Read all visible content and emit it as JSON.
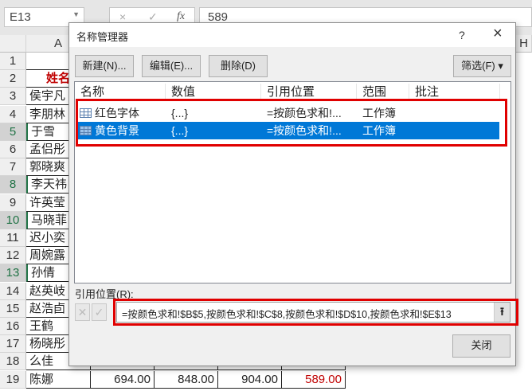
{
  "toolbar": {
    "name_box": "E13",
    "cancel_icon": "×",
    "enter_icon": "✓",
    "fx": "fx",
    "formula_value": "589"
  },
  "columns": [
    "A",
    "H"
  ],
  "rows": [
    {
      "n": "1",
      "name": "",
      "sel": false
    },
    {
      "n": "2",
      "name": "姓名",
      "sel": false
    },
    {
      "n": "3",
      "name": "侯宇凡",
      "sel": false
    },
    {
      "n": "4",
      "name": "李朋林",
      "sel": false
    },
    {
      "n": "5",
      "name": "于雪",
      "sel": true
    },
    {
      "n": "6",
      "name": "孟侣彤",
      "sel": false
    },
    {
      "n": "7",
      "name": "郭晓爽",
      "sel": false
    },
    {
      "n": "8",
      "name": "李天祎",
      "sel": true
    },
    {
      "n": "9",
      "name": "许英莹",
      "sel": false
    },
    {
      "n": "10",
      "name": "马晓菲",
      "sel": true
    },
    {
      "n": "11",
      "name": "迟小奕",
      "sel": false
    },
    {
      "n": "12",
      "name": "周婉露",
      "sel": false
    },
    {
      "n": "13",
      "name": "孙倩",
      "sel": true
    },
    {
      "n": "14",
      "name": "赵英岐",
      "sel": false
    },
    {
      "n": "15",
      "name": "赵浩卣",
      "sel": false
    },
    {
      "n": "16",
      "name": "王鹤",
      "sel": false
    },
    {
      "n": "17",
      "name": "杨晓彤",
      "sel": false
    },
    {
      "n": "18",
      "name": "么佳",
      "sel": false
    },
    {
      "n": "19",
      "name": "陈娜",
      "sel": false
    }
  ],
  "row19_values": [
    "694.00",
    "848.00",
    "904.00",
    "589.00"
  ],
  "dialog": {
    "title": "名称管理器",
    "help": "?",
    "close_icon": "×",
    "new_btn": "新建(N)...",
    "edit_btn": "编辑(E)...",
    "delete_btn": "删除(D)",
    "filter_btn": "筛选(F) ▾",
    "headers": [
      "名称",
      "数值",
      "引用位置",
      "范围",
      "批注"
    ],
    "items": [
      {
        "name": "红色字体",
        "value": "{...}",
        "ref": "=按颜色求和!...",
        "scope": "工作簿",
        "comment": ""
      },
      {
        "name": "黄色背景",
        "value": "{...}",
        "ref": "=按颜色求和!...",
        "scope": "工作簿",
        "comment": ""
      }
    ],
    "ref_label": "引用位置(R):",
    "ref_value": "=按颜色求和!$B$5,按颜色求和!$C$8,按颜色求和!$D$10,按颜色求和!$E$13",
    "collapse_icon": "⭱",
    "close_btn": "关闭"
  },
  "colors": {
    "accent": "#0078d7",
    "highlight": "#e00000",
    "red_text": "#c00000"
  }
}
